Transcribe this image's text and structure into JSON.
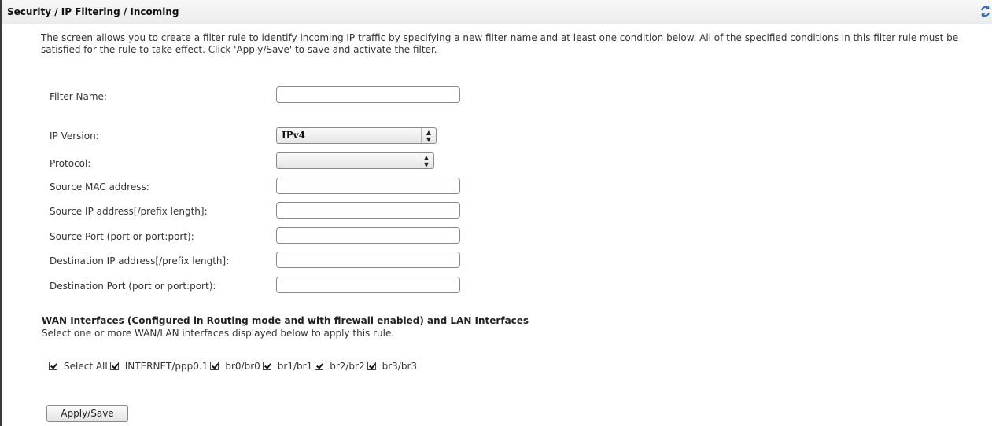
{
  "header": {
    "title": "Security / IP Filtering / Incoming",
    "refresh_icon": "refresh-icon"
  },
  "description": "The screen allows you to create a filter rule to identify incoming IP traffic by specifying a new filter name and at least one condition below. All of the specified conditions in this filter rule must be satisfied for the rule to take effect. Click 'Apply/Save' to save and activate the filter.",
  "form": {
    "filter_name": {
      "label": "Filter Name:",
      "value": ""
    },
    "ip_version": {
      "label": "IP Version:",
      "value": "IPv4"
    },
    "protocol": {
      "label": "Protocol:",
      "value": ""
    },
    "source_mac": {
      "label": "Source MAC address:",
      "value": ""
    },
    "source_ip": {
      "label": "Source IP address[/prefix length]:",
      "value": ""
    },
    "source_port": {
      "label": "Source Port (port or port:port):",
      "value": ""
    },
    "dest_ip": {
      "label": "Destination IP address[/prefix length]:",
      "value": ""
    },
    "dest_port": {
      "label": "Destination Port (port or port:port):",
      "value": ""
    }
  },
  "interfaces": {
    "title": "WAN Interfaces (Configured in Routing mode and with firewall enabled) and LAN Interfaces",
    "subtitle": "Select one or more WAN/LAN interfaces displayed below to apply this rule.",
    "items": [
      {
        "label": "Select All",
        "checked": true
      },
      {
        "label": "INTERNET/ppp0.1",
        "checked": true
      },
      {
        "label": "br0/br0",
        "checked": true
      },
      {
        "label": "br1/br1",
        "checked": true
      },
      {
        "label": "br2/br2",
        "checked": true
      },
      {
        "label": "br3/br3",
        "checked": true
      }
    ]
  },
  "buttons": {
    "apply_save": "Apply/Save"
  }
}
